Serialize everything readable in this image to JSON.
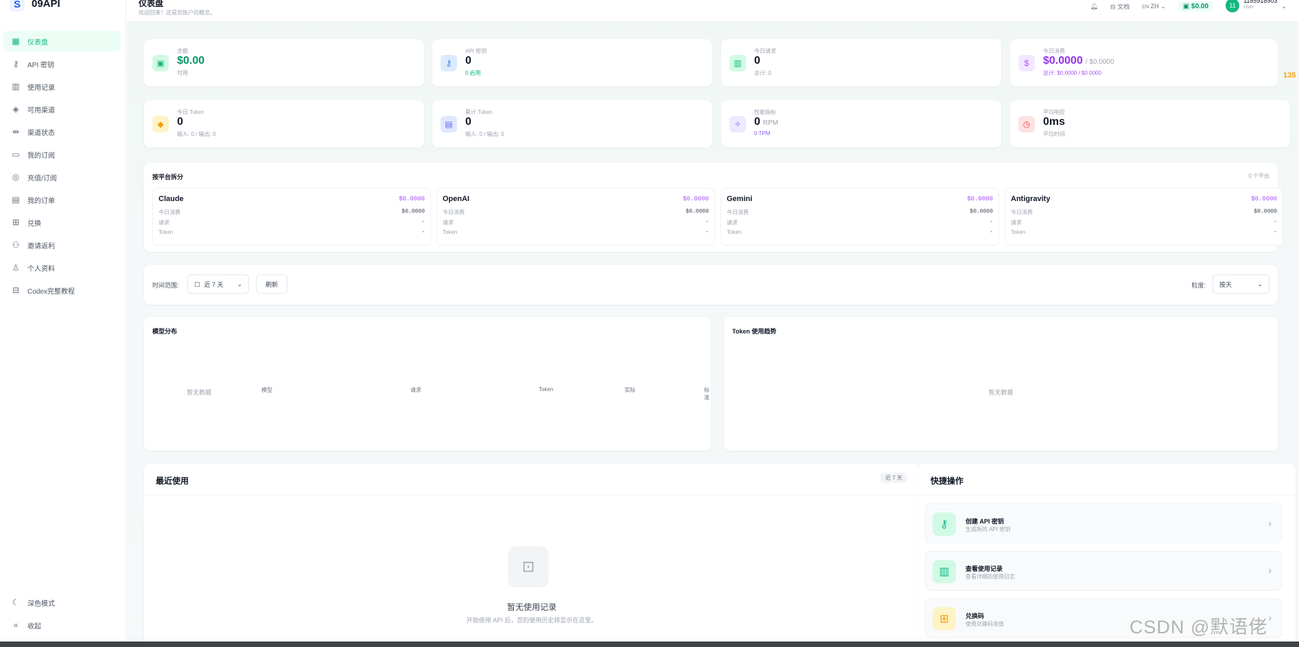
{
  "brand": {
    "name": "09API",
    "logo_icon": "app-logo-icon"
  },
  "sidebar": {
    "items": [
      {
        "label": "仪表盘",
        "icon": "dashboard-icon",
        "glyph": "▦",
        "active": true
      },
      {
        "label": "API 密钥",
        "icon": "key-icon",
        "glyph": "⚷",
        "active": false
      },
      {
        "label": "使用记录",
        "icon": "bar-chart-icon",
        "glyph": "▥",
        "active": false
      },
      {
        "label": "可用渠道",
        "icon": "layers-icon",
        "glyph": "◈",
        "active": false
      },
      {
        "label": "渠道状态",
        "icon": "status-icon",
        "glyph": "⇹",
        "active": false
      },
      {
        "label": "我的订阅",
        "icon": "subscription-icon",
        "glyph": "▭",
        "active": false
      },
      {
        "label": "充值/订阅",
        "icon": "recharge-icon",
        "glyph": "◎",
        "active": false
      },
      {
        "label": "我的订单",
        "icon": "order-icon",
        "glyph": "▤",
        "active": false
      },
      {
        "label": "兑换",
        "icon": "gift-icon",
        "glyph": "⊞",
        "active": false
      },
      {
        "label": "邀请返利",
        "icon": "invite-icon",
        "glyph": "⚇",
        "active": false
      },
      {
        "label": "个人资料",
        "icon": "user-icon",
        "glyph": "♙",
        "active": false
      },
      {
        "label": "Codex完整教程",
        "icon": "book-icon",
        "glyph": "⊟",
        "active": false
      }
    ],
    "bottom": [
      {
        "label": "深色模式",
        "icon": "moon-icon",
        "glyph": "☾"
      },
      {
        "label": "收起",
        "icon": "collapse-icon",
        "glyph": "«"
      }
    ]
  },
  "header": {
    "title": "仪表盘",
    "subtitle": "欢迎回来！这是您账户的概览。",
    "docs_label": "文档",
    "lang_flag": "CN",
    "lang_label": "ZH",
    "balance": "$0.00",
    "avatar_text": "11",
    "user_name": "1185918903",
    "user_role": "User"
  },
  "stats": [
    {
      "label": "余额",
      "value": "$0.00",
      "value_extra": "",
      "sub": "可用",
      "icon": "wallet-icon",
      "glyph": "▣",
      "icon_color": "#10b981",
      "icon_bg": "#d1fae5",
      "value_color": "#059669",
      "sub_color": "#9ca3af"
    },
    {
      "label": "API 密钥",
      "value": "0",
      "value_extra": "",
      "sub": "0 启用",
      "icon": "key-icon",
      "glyph": "⚷",
      "icon_color": "#3b82f6",
      "icon_bg": "#dbeafe",
      "value_color": "#111827",
      "sub_color": "#10b981"
    },
    {
      "label": "今日请求",
      "value": "0",
      "value_extra": "",
      "sub": "总计: 0",
      "icon": "bar-chart-icon",
      "glyph": "▥",
      "icon_color": "#10b981",
      "icon_bg": "#d1fae5",
      "value_color": "#111827",
      "sub_color": "#9ca3af"
    },
    {
      "label": "今日消费",
      "value": "$0.0000",
      "value_extra": "/ $0.0000",
      "sub": "总计: $0.0000 / $0.0000",
      "icon": "dollar-icon",
      "glyph": "$",
      "icon_color": "#a855f7",
      "icon_bg": "#f3e8ff",
      "value_color": "#9333ea",
      "sub_color": "#a855f7"
    },
    {
      "label": "今日 Token",
      "value": "0",
      "value_extra": "",
      "sub": "输入: 0 / 输出: 0",
      "icon": "cube-icon",
      "glyph": "◆",
      "icon_color": "#f59e0b",
      "icon_bg": "#fef3c7",
      "value_color": "#111827",
      "sub_color": "#9ca3af"
    },
    {
      "label": "累计 Token",
      "value": "0",
      "value_extra": "",
      "sub": "输入: 0 / 输出: 0",
      "icon": "database-icon",
      "glyph": "▤",
      "icon_color": "#6366f1",
      "icon_bg": "#e0e7ff",
      "value_color": "#111827",
      "sub_color": "#9ca3af"
    },
    {
      "label": "性能指标",
      "value": "0",
      "value_extra": "RPM",
      "sub": "0  TPM",
      "icon": "sparkle-icon",
      "glyph": "✧",
      "icon_color": "#8b5cf6",
      "icon_bg": "#ede9fe",
      "value_color": "#111827",
      "sub_color": "#8b5cf6"
    },
    {
      "label": "平均响应",
      "value": "0ms",
      "value_extra": "",
      "sub": "平均时间",
      "icon": "clock-icon",
      "glyph": "◷",
      "icon_color": "#ef4444",
      "icon_bg": "#fee2e2",
      "value_color": "#111827",
      "sub_color": "#9ca3af"
    }
  ],
  "platforms": {
    "title": "按平台拆分",
    "count": "0 个平台",
    "row_labels": {
      "today_cost": "今日消费",
      "requests": "请求",
      "token": "Token"
    },
    "items": [
      {
        "name": "Claude",
        "cost": "$0.0000",
        "today_cost": "$0.0000",
        "requests": "-",
        "token": "-"
      },
      {
        "name": "OpenAI",
        "cost": "$0.0000",
        "today_cost": "$0.0000",
        "requests": "-",
        "token": "-"
      },
      {
        "name": "Gemini",
        "cost": "$0.0000",
        "today_cost": "$0.0000",
        "requests": "-",
        "token": "-"
      },
      {
        "name": "Antigravity",
        "cost": "$0.0000",
        "today_cost": "$0.0000",
        "requests": "-",
        "token": "-"
      }
    ]
  },
  "filters": {
    "time_range_label": "时间范围:",
    "time_range_value": "近 7 天",
    "refresh_label": "刷新",
    "granularity_label": "粒度:",
    "granularity_value": "按天"
  },
  "model_distribution": {
    "title": "模型分布",
    "empty": "暂无数据",
    "columns": [
      "模型",
      "请求",
      "Token",
      "实际",
      "标准"
    ]
  },
  "token_trend": {
    "title": "Token 使用趋势",
    "empty": "暂无数据"
  },
  "recent": {
    "title": "最近使用",
    "range": "近 7 天",
    "empty_title": "暂无使用记录",
    "empty_desc": "开始使用 API 后，您的使用历史将显示在这里。"
  },
  "quick_actions": {
    "title": "快捷操作",
    "items": [
      {
        "title": "创建 API 密钥",
        "desc": "生成新的 API 密钥",
        "icon": "key-icon",
        "glyph": "⚷",
        "icon_color": "#10b981",
        "icon_bg": "#d1fae5"
      },
      {
        "title": "查看使用记录",
        "desc": "查看详细的使用日志",
        "icon": "bar-chart-icon",
        "glyph": "▥",
        "icon_color": "#10b981",
        "icon_bg": "#d1fae5"
      },
      {
        "title": "兑换码",
        "desc": "使用兑换码充值",
        "icon": "gift-icon",
        "glyph": "⊞",
        "icon_color": "#f59e0b",
        "icon_bg": "#fef3c7"
      }
    ]
  },
  "watermark": "CSDN @默语佬",
  "side_badge": "135"
}
